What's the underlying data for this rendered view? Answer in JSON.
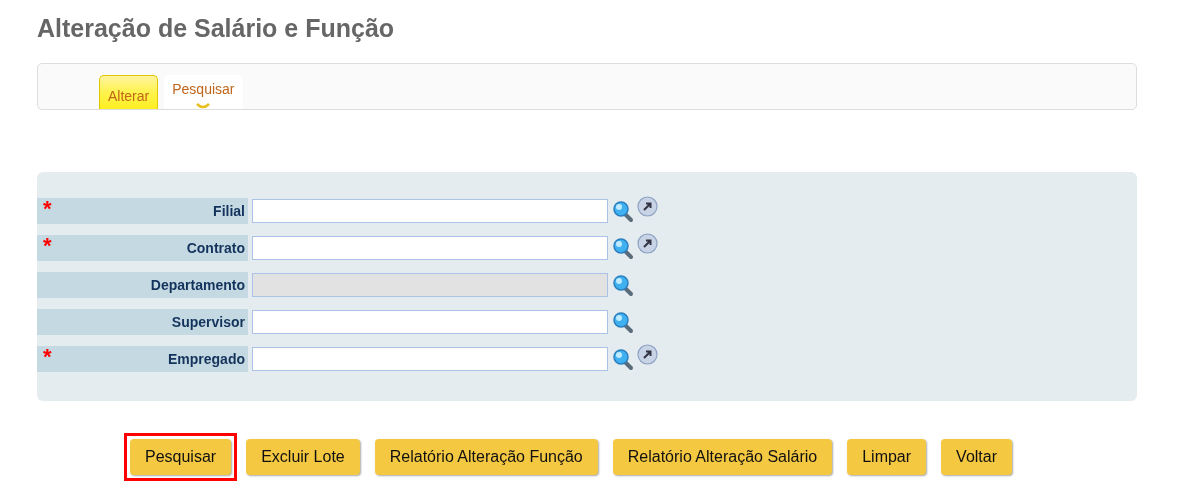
{
  "title": "Alteração de Salário e Função",
  "tabs": [
    {
      "label": "Alterar",
      "selected": false
    },
    {
      "label": "Pesquisar",
      "selected": true
    }
  ],
  "fields": [
    {
      "label": "Filial",
      "required": true,
      "disabled": false,
      "open_icon": true
    },
    {
      "label": "Contrato",
      "required": true,
      "disabled": false,
      "open_icon": true
    },
    {
      "label": "Departamento",
      "required": false,
      "disabled": true,
      "open_icon": false
    },
    {
      "label": "Supervisor",
      "required": false,
      "disabled": false,
      "open_icon": false
    },
    {
      "label": "Empregado",
      "required": true,
      "disabled": false,
      "open_icon": true
    }
  ],
  "required_mark": "*",
  "buttons": [
    {
      "label": "Pesquisar",
      "highlighted": true
    },
    {
      "label": "Excluir Lote",
      "highlighted": false
    },
    {
      "label": "Relatório Alteração Função",
      "highlighted": false
    },
    {
      "label": "Relatório Alteração Salário",
      "highlighted": false
    },
    {
      "label": "Limpar",
      "highlighted": false
    },
    {
      "label": "Voltar",
      "highlighted": false
    }
  ]
}
